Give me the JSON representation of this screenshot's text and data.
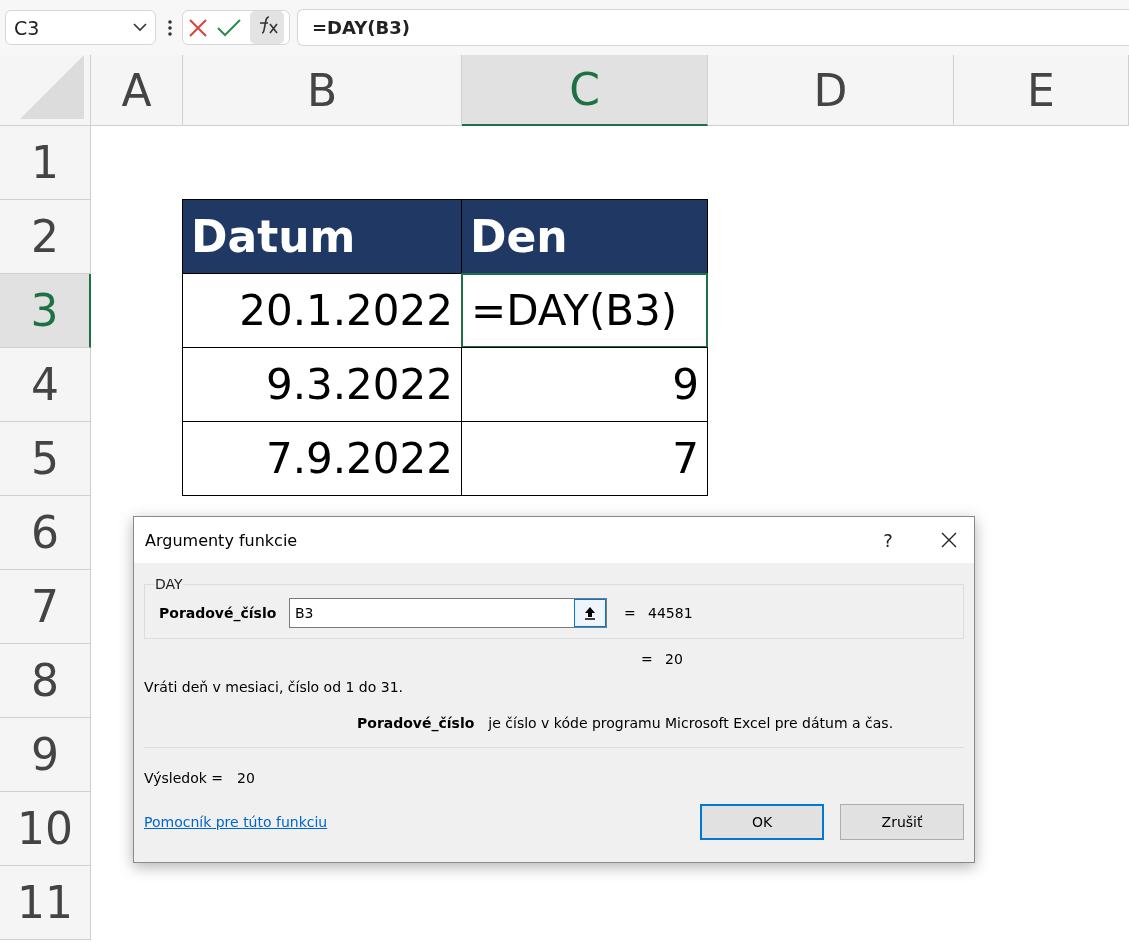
{
  "name_box": {
    "value": "C3"
  },
  "formula_bar": {
    "formula": "=DAY(B3)"
  },
  "columns": [
    {
      "label": "A",
      "selected": false
    },
    {
      "label": "B",
      "selected": false
    },
    {
      "label": "C",
      "selected": true
    },
    {
      "label": "D",
      "selected": false
    },
    {
      "label": "E",
      "selected": false
    }
  ],
  "rows": [
    {
      "label": "1",
      "selected": false
    },
    {
      "label": "2",
      "selected": false
    },
    {
      "label": "3",
      "selected": true
    },
    {
      "label": "4",
      "selected": false
    },
    {
      "label": "5",
      "selected": false
    },
    {
      "label": "6",
      "selected": false
    },
    {
      "label": "7",
      "selected": false
    },
    {
      "label": "8",
      "selected": false
    },
    {
      "label": "9",
      "selected": false
    },
    {
      "label": "10",
      "selected": false
    },
    {
      "label": "11",
      "selected": false
    }
  ],
  "table": {
    "header": [
      "Datum",
      "Den"
    ],
    "rows": [
      [
        {
          "text": "20.1.2022",
          "selected": false
        },
        {
          "text": "=DAY(B3)",
          "selected": true
        }
      ],
      [
        {
          "text": "9.3.2022",
          "selected": false
        },
        {
          "text": "9",
          "selected": false
        }
      ],
      [
        {
          "text": "7.9.2022",
          "selected": false
        },
        {
          "text": "7",
          "selected": false
        }
      ]
    ]
  },
  "dialog": {
    "title": "Argumenty funkcie",
    "help_mark": "?",
    "function_name": "DAY",
    "argument": {
      "label": "Poradové_číslo",
      "value": "B3",
      "equals": "=",
      "evaluated": "44581"
    },
    "result_preview": {
      "equals": "=",
      "value": "20"
    },
    "description": "Vráti deň v mesiaci, číslo od 1 do 31.",
    "argument_help": {
      "name": "Poradové_číslo",
      "text": "je číslo v kóde programu Microsoft Excel pre dátum a čas."
    },
    "result": {
      "label": "Výsledok =",
      "value": "20"
    },
    "help_link": "Pomocník pre túto funkciu",
    "buttons": [
      {
        "label": "OK",
        "kind": "primary"
      },
      {
        "label": "Zrušiť",
        "kind": "secondary"
      }
    ]
  }
}
